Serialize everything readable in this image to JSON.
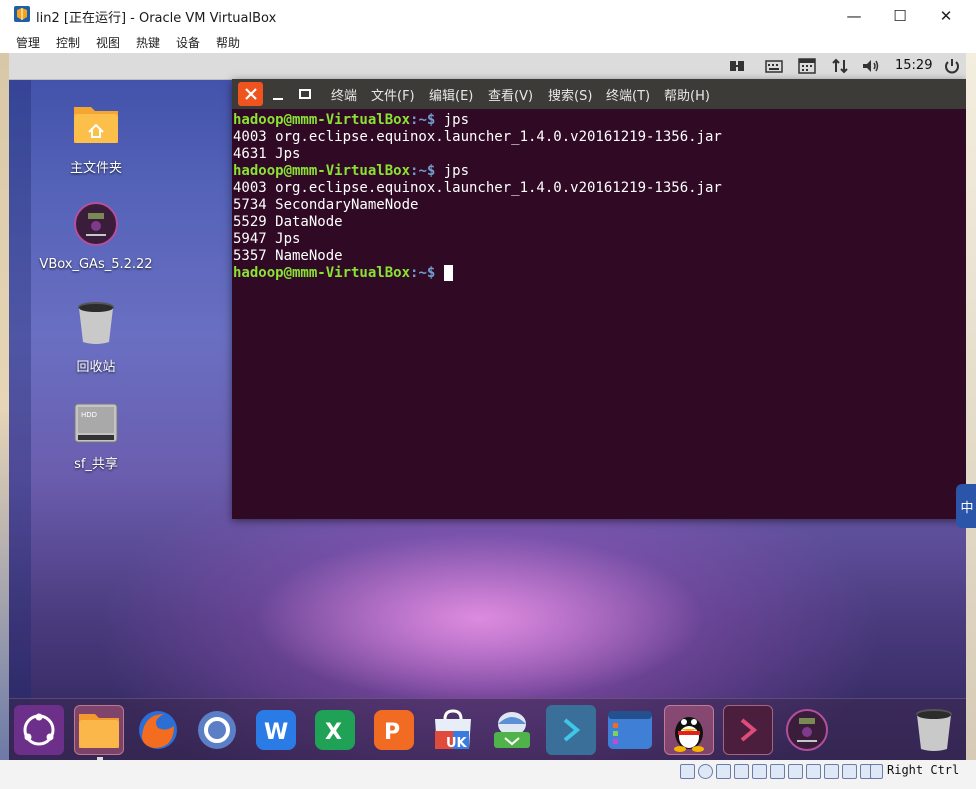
{
  "window": {
    "title": "lin2 [正在运行] - Oracle VM VirtualBox",
    "minimize": "—",
    "maximize": "☐",
    "close": "✕"
  },
  "menubar": {
    "items": [
      "管理",
      "控制",
      "视图",
      "热键",
      "设备",
      "帮助"
    ]
  },
  "guest_panel": {
    "clock": "15:29",
    "tray_icons": [
      "network-icon",
      "keyboard-icon",
      "calendar-icon",
      "transfer-icon",
      "volume-icon",
      "power-icon"
    ]
  },
  "desktop": {
    "icons": [
      {
        "label": "主文件夹",
        "icon": "home-folder-icon"
      },
      {
        "label": "VBox_GAs_5.2.22",
        "icon": "cd-disc-icon"
      },
      {
        "label": "回收站",
        "icon": "trash-icon"
      },
      {
        "label": "sf_共享",
        "icon": "hdd-icon"
      }
    ]
  },
  "terminal": {
    "menu": [
      "终端",
      "文件(F)",
      "编辑(E)",
      "查看(V)",
      "搜索(S)",
      "终端(T)",
      "帮助(H)"
    ],
    "prompt_user": "hadoop@mmm-VirtualBox",
    "prompt_path": ":~$",
    "lines": [
      {
        "type": "prompt",
        "cmd": " jps"
      },
      {
        "type": "out",
        "text": "4003 org.eclipse.equinox.launcher_1.4.0.v20161219-1356.jar"
      },
      {
        "type": "out",
        "text": "4631 Jps"
      },
      {
        "type": "prompt",
        "cmd": " jps"
      },
      {
        "type": "out",
        "text": "4003 org.eclipse.equinox.launcher_1.4.0.v20161219-1356.jar"
      },
      {
        "type": "out",
        "text": "5734 SecondaryNameNode"
      },
      {
        "type": "out",
        "text": "5529 DataNode"
      },
      {
        "type": "out",
        "text": "5947 Jps"
      },
      {
        "type": "out",
        "text": "5357 NameNode"
      },
      {
        "type": "prompt",
        "cmd": " "
      }
    ]
  },
  "dock": {
    "items": [
      "ubuntu-logo-icon",
      "files-icon",
      "firefox-icon",
      "browser-icon",
      "wps-writer-icon",
      "wps-spreadsheet-icon",
      "wps-presentation-icon",
      "ukylin-store-icon",
      "software-updater-icon",
      "terminal-icon",
      "system-monitor-icon",
      "qq-icon",
      "terminal-active-icon",
      "cd-disc-icon",
      "trash-icon"
    ]
  },
  "ime": {
    "label": "中"
  },
  "statusbar": {
    "host_key": "Right Ctrl"
  },
  "colors": {
    "terminal_bg": "#300a24",
    "prompt_user": "#8ae234",
    "prompt_path": "#729fcf",
    "term_close": "#f0541e"
  }
}
